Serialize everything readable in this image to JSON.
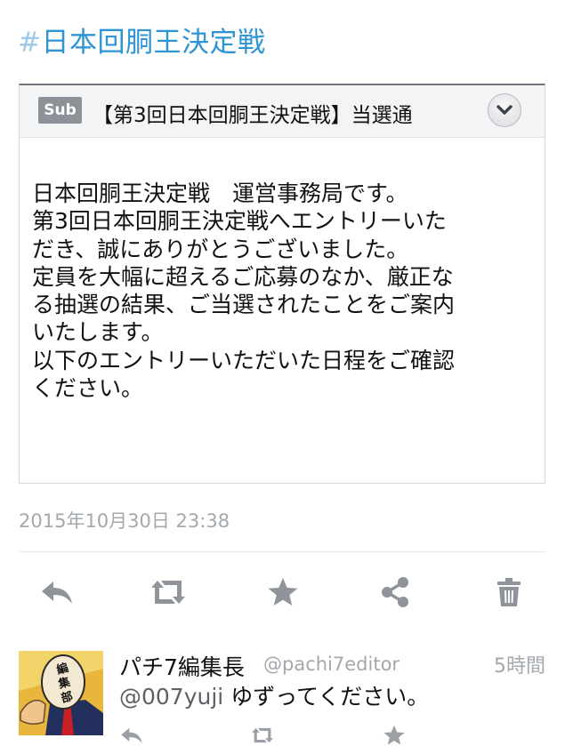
{
  "hashtag": {
    "symbol": "#",
    "text": "日本回胴王決定戦"
  },
  "message": {
    "badge": "Sub",
    "subject": "【第3回日本回胴王決定戦】当選通",
    "body_lines": [
      "日本回胴王決定戦　運営事務局です。",
      "第3回日本回胴王決定戦へエントリーいた",
      "だき、誠にありがとうございました。",
      "定員を大幅に超えるご応募のなか、厳正な",
      "る抽選の結果、ご当選されたことをご案内",
      "いたします。",
      "以下のエントリーいただいた日程をご確認",
      "ください。"
    ]
  },
  "timestamp": "2015年10月30日 23:38",
  "actions": {
    "reply_icon": "reply-arrow-icon",
    "retweet_icon": "retweet-icon",
    "favorite_icon": "star-icon",
    "share_icon": "share-icon",
    "delete_icon": "trash-icon"
  },
  "reply": {
    "name": "パチ7編集長",
    "handle": "@pachi7editor",
    "time": "5時間",
    "mention": "@007yuji",
    "text": " ゆずってください。"
  },
  "colors": {
    "hashtag": "#2f94d6",
    "icon": "#8e9499",
    "muted": "#a3a8ad"
  }
}
